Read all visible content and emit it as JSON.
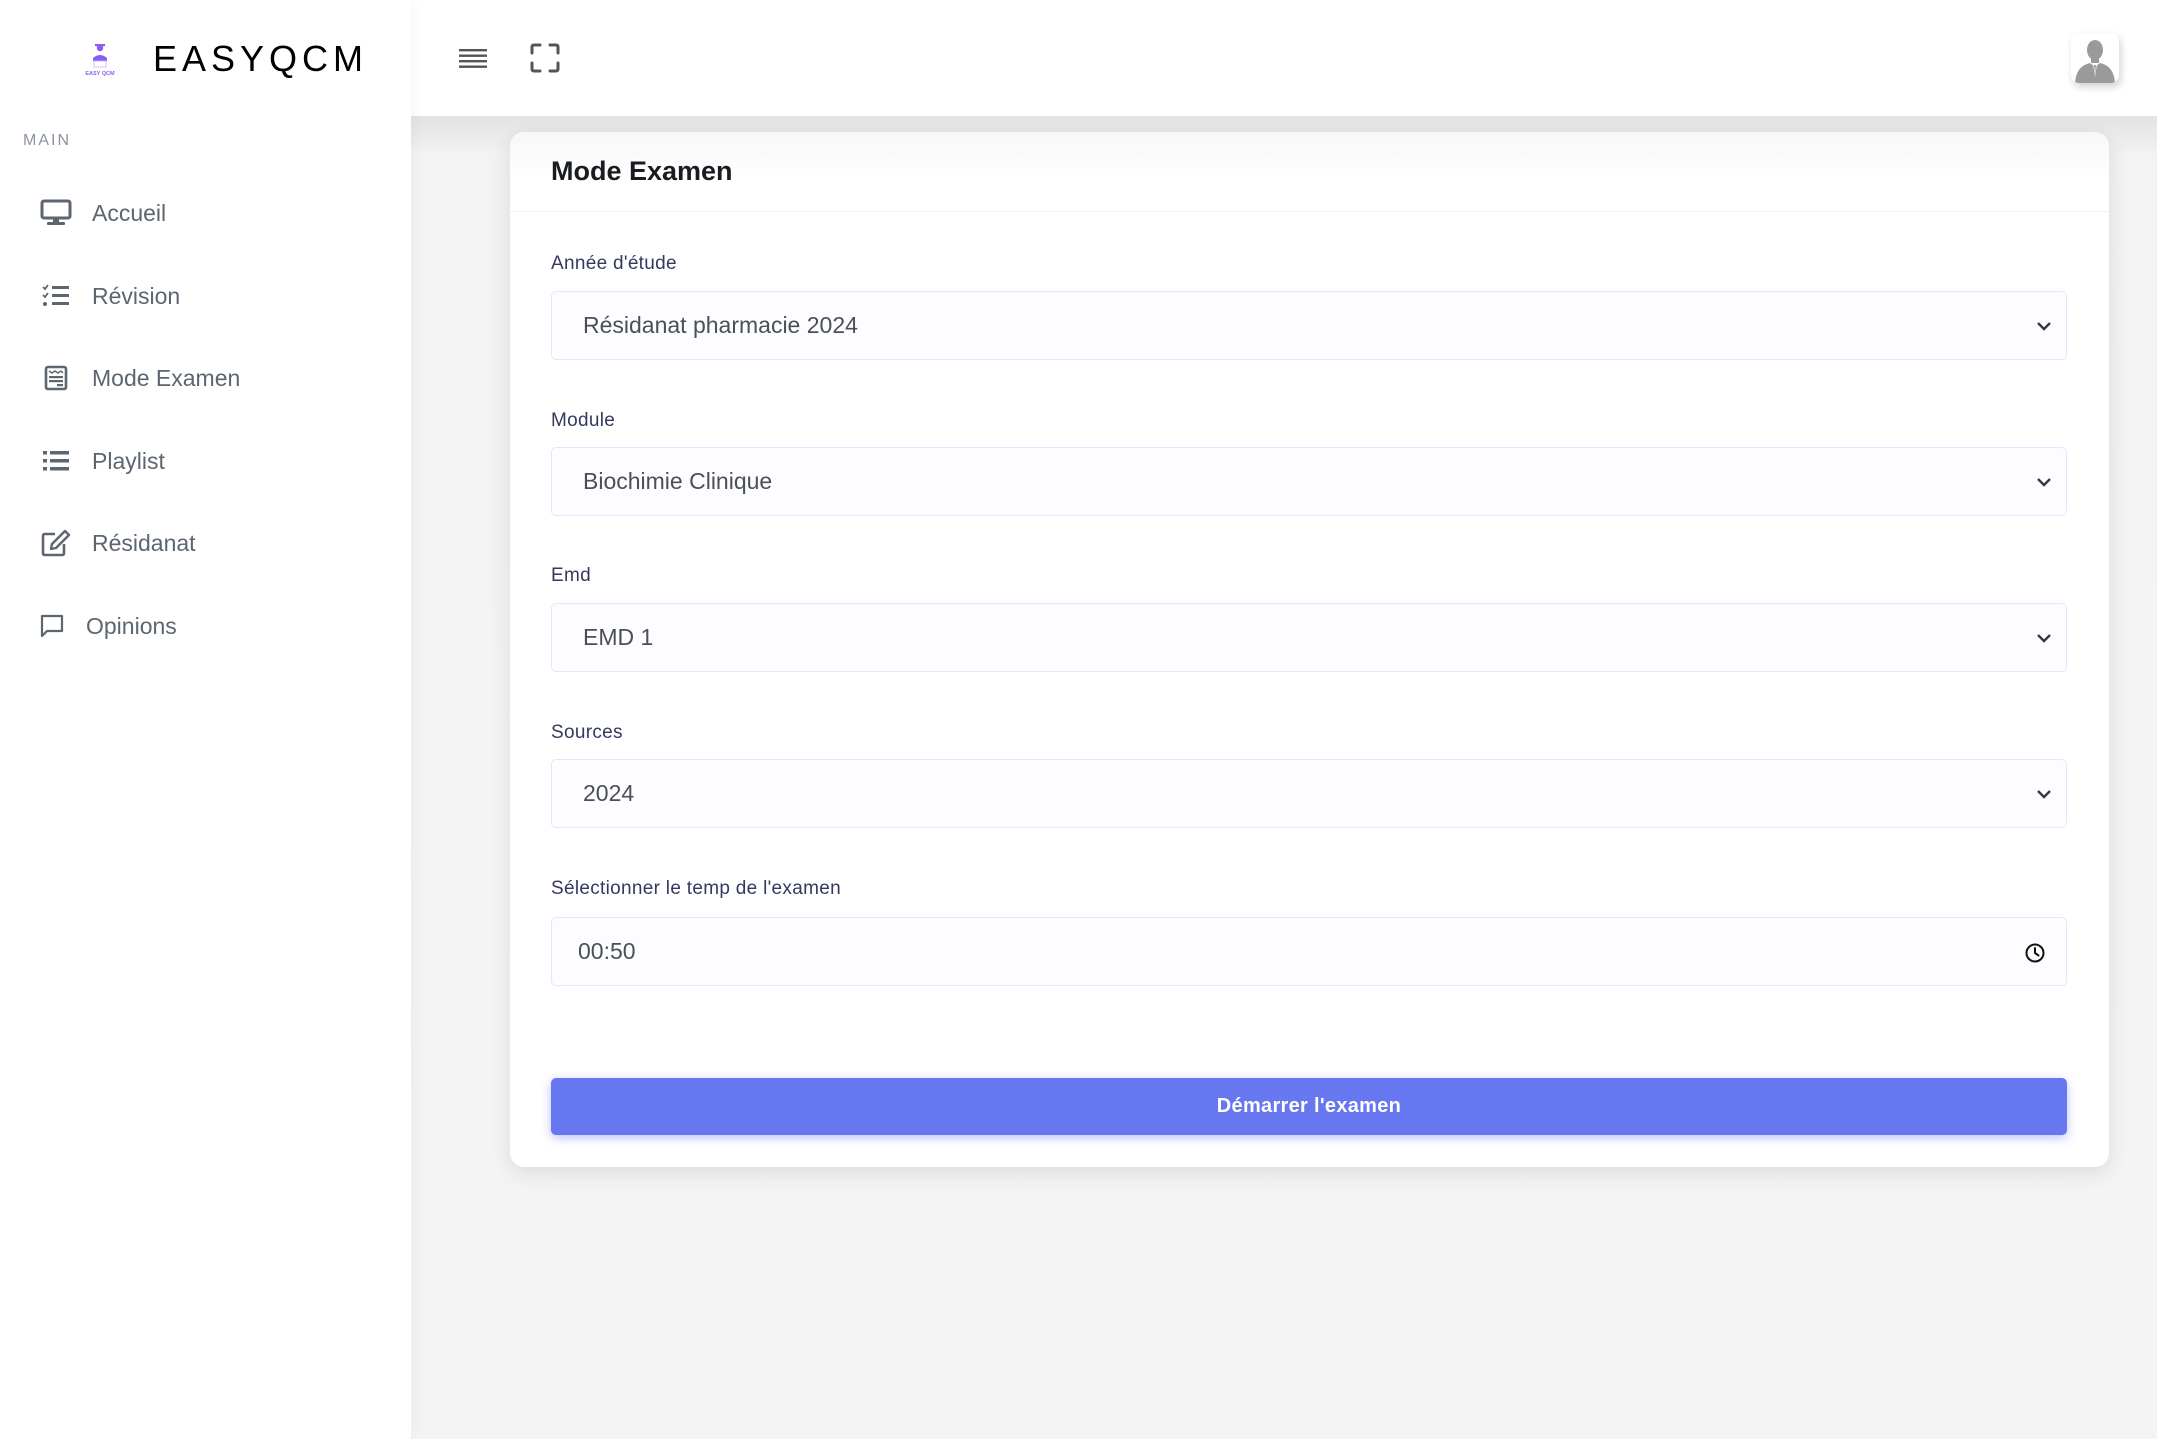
{
  "brand": {
    "name": "EASYQCM",
    "logo_caption": "EASY QCM",
    "logo_color": "#8b5cf6"
  },
  "sidebar": {
    "section_header": "MAIN",
    "items": [
      {
        "label": "Accueil",
        "icon": "desktop-icon"
      },
      {
        "label": "Révision",
        "icon": "checklist-icon"
      },
      {
        "label": "Mode Examen",
        "icon": "exam-calendar-icon"
      },
      {
        "label": "Playlist",
        "icon": "list-icon"
      },
      {
        "label": "Résidanat",
        "icon": "edit-icon"
      },
      {
        "label": "Opinions",
        "icon": "comment-icon"
      }
    ]
  },
  "header": {
    "menu_toggle_icon": "hamburger-icon",
    "fullscreen_icon": "fullscreen-icon",
    "avatar_icon": "user-avatar-icon"
  },
  "card": {
    "title": "Mode Examen",
    "fields": [
      {
        "label": "Année d'étude",
        "value": "Résidanat pharmacie 2024",
        "type": "select"
      },
      {
        "label": "Module",
        "value": "Biochimie Clinique",
        "type": "select"
      },
      {
        "label": "Emd",
        "value": "EMD 1",
        "type": "select"
      },
      {
        "label": "Sources",
        "value": "2024",
        "type": "select"
      },
      {
        "label": "Sélectionner le temp de l'examen",
        "value": "00:50",
        "type": "time"
      }
    ],
    "submit_label": "Démarrer l'examen"
  },
  "colors": {
    "primary": "#6777ef",
    "sidebar_text": "#5c6670",
    "label_text": "#34395e"
  }
}
